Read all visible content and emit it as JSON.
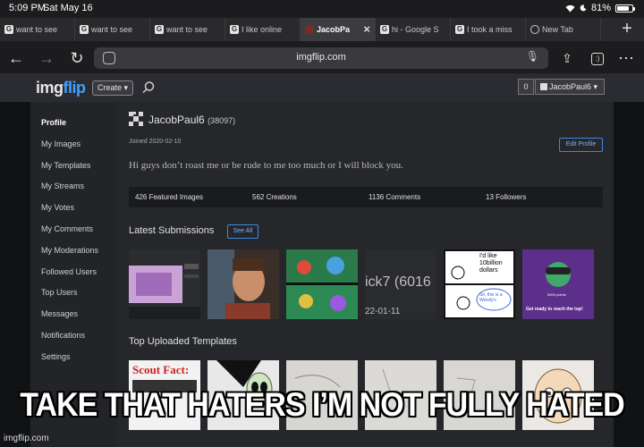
{
  "status_bar": {
    "time": "5:09 PM",
    "date": "Sat May 16",
    "battery": "81%",
    "battery_level": 0.81
  },
  "browser": {
    "tabs": [
      {
        "label": "want to see",
        "favicon": "G",
        "active": false
      },
      {
        "label": "want to see",
        "favicon": "G",
        "active": false
      },
      {
        "label": "want to see",
        "favicon": "G",
        "active": false
      },
      {
        "label": "I like online",
        "favicon": "G",
        "active": false
      },
      {
        "label": "JacobPa",
        "favicon": "",
        "active": true
      },
      {
        "label": "hi - Google S",
        "favicon": "G",
        "active": false
      },
      {
        "label": "I took a miss",
        "favicon": "G",
        "active": false
      },
      {
        "label": "New Tab",
        "favicon": "",
        "active": false
      }
    ],
    "url": "imgflip.com"
  },
  "site_header": {
    "logo_part1": "img",
    "logo_part2": "flip",
    "create_label": "Create ▾",
    "notification_count": "0",
    "user_label": "JacobPaul6 ▾"
  },
  "sidebar": {
    "items": [
      {
        "label": "Profile"
      },
      {
        "label": "My Images"
      },
      {
        "label": "My Templates"
      },
      {
        "label": "My Streams"
      },
      {
        "label": "My Votes"
      },
      {
        "label": "My Comments"
      },
      {
        "label": "My Moderations"
      },
      {
        "label": "Followed Users"
      },
      {
        "label": "Top Users"
      },
      {
        "label": "Messages"
      },
      {
        "label": "Notifications"
      },
      {
        "label": "Settings"
      }
    ]
  },
  "profile": {
    "username": "JacobPaul6",
    "points": "(38097)",
    "joined": "Joined 2020-02-10",
    "edit_label": "Edit Profile",
    "bio": "Hi guys don’t roast me or be rude to me too much or I will block you.",
    "stats": {
      "featured": "426 Featured Images",
      "creations": "562 Creations",
      "comments": "1136 Comments",
      "followers": "13 Followers"
    },
    "latest_title": "Latest Submissions",
    "see_all": "See All",
    "top_templates_title": "Top Uploaded Templates",
    "thumb4_text": "ick7 (6016",
    "thumb4_date": "22-01-11",
    "thumb5_bubble": "I'd like 10billion dollars",
    "thumb5_bubble2": "Sir, this is a Wendy's",
    "thumb6_text": "Get ready to reach the top!",
    "thumb6_points": "5000 points",
    "bottom1_text": "Scout Fact:"
  },
  "meme": {
    "caption": "TAKE THAT HATERS I’M NOT FULLY HATED",
    "watermark": "imgflip.com"
  }
}
